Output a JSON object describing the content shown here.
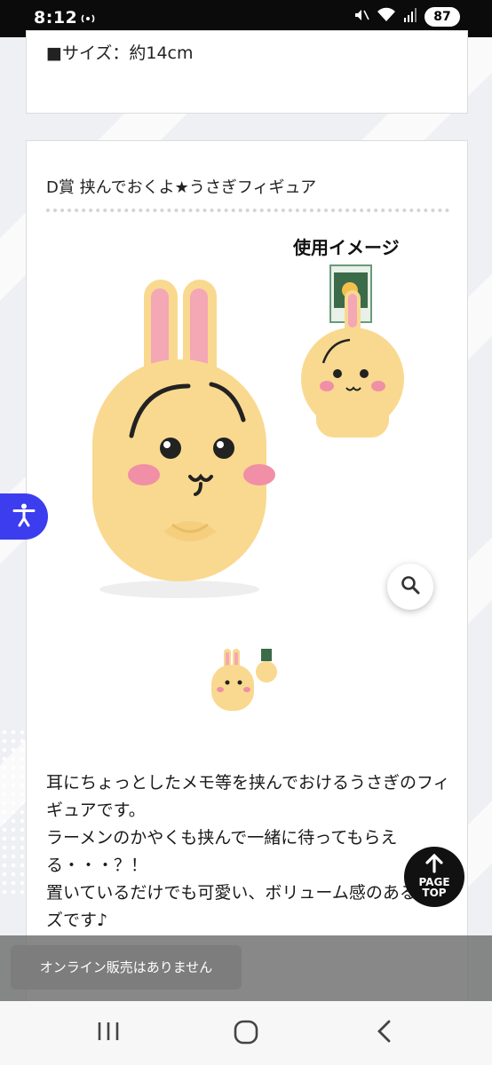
{
  "status_bar": {
    "time": "8:12",
    "battery": "87",
    "icons": [
      "hotspot-icon",
      "mute-icon",
      "wifi-icon",
      "signal-icon",
      "battery-icon"
    ]
  },
  "product_top": {
    "size_text": "■サイズ：約14cm"
  },
  "product": {
    "title": "D賞 挟んでおくよ★うさぎフィギュア",
    "usage_label": "使用イメージ",
    "description": [
      "耳にちょっとしたメモ等を挟んでおけるうさぎのフィギュアです。",
      "ラーメンのかやくも挟んで一緒に待ってもらえる・・・？！",
      "置いているだけでも可愛い、ボリューム感のあるサイズです♪"
    ]
  },
  "page_top": {
    "line1": "PAGE",
    "line2": "TOP"
  },
  "toast": {
    "message": "オンライン販売はありません"
  },
  "colors": {
    "accessibility": "#3d3df0",
    "figure_body": "#f9d98f",
    "ear_pink": "#f4a7b4"
  }
}
